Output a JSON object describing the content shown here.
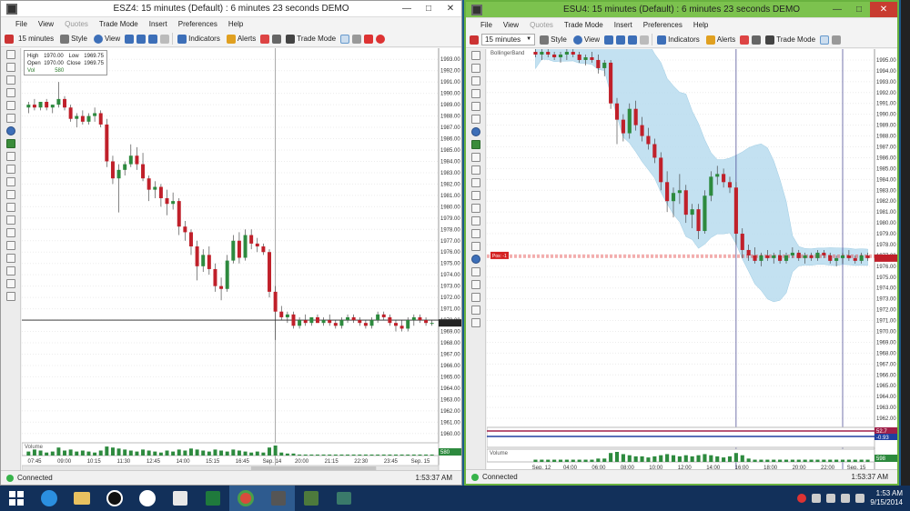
{
  "left_window": {
    "title": "ESZ4: 15 minutes (Default) : 6 minutes 23 seconds DEMO",
    "menu": [
      {
        "label": "File",
        "dim": false
      },
      {
        "label": "View",
        "dim": false
      },
      {
        "label": "Quotes",
        "dim": true
      },
      {
        "label": "Trade Mode",
        "dim": false
      },
      {
        "label": "Insert",
        "dim": false
      },
      {
        "label": "Preferences",
        "dim": false
      },
      {
        "label": "Help",
        "dim": false
      }
    ],
    "toolbar": {
      "interval": "15 minutes",
      "style": "Style",
      "view": "View",
      "indicators": "Indicators",
      "alerts": "Alerts",
      "trade_mode": "Trade Mode"
    },
    "databox": {
      "high_label": "High",
      "high": "1970.00",
      "low_label": "Low",
      "low": "1969.75",
      "open_label": "Open",
      "open": "1970.00",
      "close_label": "Close",
      "close": "1969.75",
      "vol_label": "Vol",
      "vol": "580"
    },
    "status": {
      "text": "Connected",
      "time": "1:53:37 AM"
    },
    "volume_label": "Volume",
    "price_tag": "1969.75",
    "vol_tag": "580"
  },
  "right_window": {
    "title": "ESU4: 15 minutes (Default) : 6 minutes 23 seconds DEMO",
    "menu": [
      {
        "label": "File",
        "dim": false
      },
      {
        "label": "View",
        "dim": false
      },
      {
        "label": "Quotes",
        "dim": true
      },
      {
        "label": "Trade Mode",
        "dim": false
      },
      {
        "label": "Insert",
        "dim": false
      },
      {
        "label": "Preferences",
        "dim": false
      },
      {
        "label": "Help",
        "dim": false
      }
    ],
    "toolbar": {
      "interval": "15 minutes",
      "style": "Style",
      "view": "View",
      "indicators": "Indicators",
      "alerts": "Alerts",
      "trade_mode": "Trade Mode"
    },
    "indicator_label": "BollingerBand",
    "position_tag": "Pos: -1",
    "status": {
      "text": "Connected",
      "time": "1:53:37 AM"
    },
    "volume_label": "Volume",
    "rsi_values": [
      "52.7",
      "-0.93"
    ],
    "vol_tag": "598"
  },
  "taskbar": {
    "time": "1:53 AM",
    "date": "9/15/2014",
    "apps": [
      "windows-start",
      "internet-explorer",
      "file-explorer",
      "media-app",
      "hp-app",
      "office-grid",
      "excel",
      "chrome",
      "trading-app-1",
      "trading-app-2",
      "photo-app"
    ]
  },
  "chart_data": [
    {
      "type": "candlestick",
      "symbol": "ESZ4",
      "interval": "15 minutes",
      "yticks": [
        "1993.00",
        "1992.00",
        "1991.00",
        "1990.00",
        "1989.00",
        "1988.00",
        "1987.00",
        "1986.00",
        "1985.00",
        "1984.00",
        "1983.00",
        "1982.00",
        "1981.00",
        "1980.00",
        "1979.00",
        "1978.00",
        "1977.00",
        "1976.00",
        "1975.00",
        "1974.00",
        "1973.00",
        "1972.00",
        "1971.00",
        "1970.00",
        "1969.00",
        "1968.00",
        "1967.00",
        "1966.00",
        "1965.00",
        "1964.00",
        "1963.00",
        "1962.00",
        "1961.00",
        "1960.00"
      ],
      "ylim": [
        1959.5,
        1993.5
      ],
      "xticks": [
        "07:45",
        "09:00",
        "10:15",
        "11:30",
        "12:45",
        "14:00",
        "15:15",
        "16:45",
        "Sep. 14",
        "20:00",
        "21:15",
        "22:30",
        "23:45",
        "Sep. 15"
      ],
      "ohlc": [
        [
          1988.75,
          1989.25,
          1988.25,
          1989.0
        ],
        [
          1989.0,
          1989.5,
          1988.5,
          1988.75
        ],
        [
          1988.75,
          1989.25,
          1988.5,
          1989.25
        ],
        [
          1989.25,
          1989.5,
          1988.5,
          1988.75
        ],
        [
          1988.75,
          1989.0,
          1988.25,
          1989.0
        ],
        [
          1989.0,
          1991.0,
          1988.75,
          1989.5
        ],
        [
          1989.5,
          1989.75,
          1988.5,
          1988.75
        ],
        [
          1988.75,
          1989.0,
          1987.5,
          1987.75
        ],
        [
          1987.75,
          1988.25,
          1987.0,
          1988.0
        ],
        [
          1988.0,
          1988.5,
          1987.25,
          1987.5
        ],
        [
          1987.5,
          1988.25,
          1987.25,
          1988.0
        ],
        [
          1988.0,
          1988.75,
          1987.5,
          1988.25
        ],
        [
          1988.25,
          1988.5,
          1987.0,
          1987.25
        ],
        [
          1987.25,
          1987.75,
          1983.5,
          1984.0
        ],
        [
          1984.0,
          1984.5,
          1982.0,
          1982.5
        ],
        [
          1982.5,
          1983.75,
          1979.5,
          1983.25
        ],
        [
          1983.25,
          1984.0,
          1982.75,
          1983.75
        ],
        [
          1983.75,
          1985.5,
          1983.5,
          1984.5
        ],
        [
          1984.5,
          1985.25,
          1983.25,
          1983.75
        ],
        [
          1983.75,
          1984.75,
          1982.25,
          1982.5
        ],
        [
          1982.5,
          1982.75,
          1980.5,
          1981.5
        ],
        [
          1981.5,
          1982.25,
          1980.75,
          1981.75
        ],
        [
          1981.75,
          1982.0,
          1980.0,
          1980.75
        ],
        [
          1980.75,
          1981.5,
          1979.25,
          1980.25
        ],
        [
          1980.25,
          1981.25,
          1979.75,
          1980.5
        ],
        [
          1980.5,
          1980.75,
          1977.5,
          1978.25
        ],
        [
          1978.25,
          1978.75,
          1977.0,
          1977.75
        ],
        [
          1977.75,
          1978.0,
          1975.75,
          1976.5
        ],
        [
          1976.5,
          1977.0,
          1973.5,
          1974.75
        ],
        [
          1974.75,
          1976.25,
          1974.25,
          1975.75
        ],
        [
          1975.75,
          1976.5,
          1974.0,
          1974.5
        ],
        [
          1974.5,
          1975.0,
          1972.5,
          1973.0
        ],
        [
          1973.0,
          1973.75,
          1971.75,
          1972.75
        ],
        [
          1972.75,
          1975.75,
          1972.5,
          1975.25
        ],
        [
          1975.25,
          1977.5,
          1975.0,
          1977.0
        ],
        [
          1977.0,
          1977.75,
          1975.0,
          1975.5
        ],
        [
          1975.5,
          1978.0,
          1975.25,
          1977.5
        ],
        [
          1977.5,
          1978.0,
          1976.25,
          1976.75
        ],
        [
          1976.75,
          1977.25,
          1976.0,
          1976.5
        ],
        [
          1976.5,
          1976.75,
          1975.75,
          1976.0
        ],
        [
          1976.0,
          1976.25,
          1972.0,
          1972.5
        ],
        [
          1972.5,
          1973.0,
          1968.25,
          1970.75
        ],
        [
          1970.75,
          1971.25,
          1970.0,
          1970.25
        ],
        [
          1970.25,
          1970.75,
          1969.75,
          1970.5
        ],
        [
          1970.5,
          1970.75,
          1969.25,
          1969.5
        ],
        [
          1969.5,
          1970.25,
          1969.25,
          1970.0
        ],
        [
          1970.0,
          1970.5,
          1969.5,
          1969.75
        ],
        [
          1969.75,
          1970.25,
          1969.5,
          1970.25
        ],
        [
          1970.25,
          1970.5,
          1969.75,
          1969.75
        ],
        [
          1969.75,
          1970.25,
          1969.5,
          1970.0
        ],
        [
          1970.0,
          1970.5,
          1969.5,
          1969.75
        ],
        [
          1969.75,
          1970.0,
          1969.25,
          1969.5
        ],
        [
          1969.5,
          1970.25,
          1969.25,
          1970.0
        ],
        [
          1970.0,
          1970.5,
          1969.75,
          1970.25
        ],
        [
          1970.25,
          1970.5,
          1969.75,
          1970.0
        ],
        [
          1970.0,
          1970.25,
          1969.5,
          1969.75
        ],
        [
          1969.75,
          1970.0,
          1969.25,
          1969.5
        ],
        [
          1969.5,
          1970.25,
          1969.25,
          1970.0
        ],
        [
          1970.0,
          1970.75,
          1969.75,
          1970.5
        ],
        [
          1970.5,
          1970.75,
          1970.0,
          1970.25
        ],
        [
          1970.25,
          1970.5,
          1969.5,
          1969.75
        ],
        [
          1969.75,
          1970.0,
          1969.0,
          1969.5
        ],
        [
          1969.5,
          1970.0,
          1969.0,
          1969.25
        ],
        [
          1969.25,
          1970.25,
          1969.0,
          1970.0
        ],
        [
          1970.0,
          1970.5,
          1969.5,
          1970.25
        ],
        [
          1970.25,
          1970.5,
          1969.75,
          1970.0
        ],
        [
          1970.0,
          1970.25,
          1969.5,
          1969.75
        ],
        [
          1969.75,
          1970.0,
          1969.5,
          1969.75
        ]
      ],
      "volume": [
        4,
        6,
        5,
        3,
        4,
        8,
        5,
        6,
        4,
        5,
        4,
        3,
        5,
        9,
        8,
        7,
        6,
        5,
        4,
        6,
        5,
        4,
        3,
        5,
        4,
        6,
        5,
        7,
        6,
        5,
        4,
        6,
        5,
        4,
        6,
        5,
        4,
        3,
        4,
        3,
        8,
        10,
        3,
        2,
        2,
        1,
        1,
        1,
        1,
        1,
        1,
        1,
        1,
        1,
        1,
        1,
        1,
        1,
        1,
        1,
        1,
        1,
        1,
        1,
        1,
        1,
        1,
        1
      ],
      "horizontal_lines": [
        1970.0
      ],
      "vertical_line_index": 41
    },
    {
      "type": "candlestick",
      "symbol": "ESU4",
      "interval": "15 minutes",
      "indicator": "BollingerBand",
      "yticks": [
        "1995.00",
        "1994.00",
        "1993.00",
        "1992.00",
        "1991.00",
        "1990.00",
        "1989.00",
        "1988.00",
        "1987.00",
        "1986.00",
        "1985.00",
        "1984.00",
        "1983.00",
        "1982.00",
        "1981.00",
        "1980.00",
        "1979.00",
        "1978.00",
        "1977.00",
        "1976.00",
        "1975.00",
        "1974.00",
        "1973.00",
        "1972.00",
        "1971.00",
        "1970.00",
        "1969.00",
        "1968.00",
        "1967.00",
        "1966.00",
        "1965.00",
        "1964.00",
        "1963.00",
        "1962.00"
      ],
      "ylim": [
        1961.5,
        1995.5
      ],
      "xticks": [
        "Sep. 12",
        "04:00",
        "06:00",
        "08:00",
        "10:00",
        "12:00",
        "14:00",
        "16:00",
        "18:00",
        "20:00",
        "22:00",
        "Sep. 15"
      ],
      "ohlc": [
        [
          1995.75,
          1996.0,
          1995.25,
          1995.5
        ],
        [
          1995.5,
          1996.0,
          1995.0,
          1995.75
        ],
        [
          1995.75,
          1996.0,
          1995.25,
          1995.5
        ],
        [
          1995.5,
          1995.75,
          1995.0,
          1995.25
        ],
        [
          1995.25,
          1995.75,
          1994.75,
          1995.5
        ],
        [
          1995.5,
          1996.0,
          1995.0,
          1995.75
        ],
        [
          1995.75,
          1996.0,
          1995.25,
          1995.5
        ],
        [
          1995.5,
          1995.75,
          1994.75,
          1995.0
        ],
        [
          1995.0,
          1995.5,
          1994.5,
          1995.25
        ],
        [
          1995.25,
          1995.75,
          1994.75,
          1995.0
        ],
        [
          1995.0,
          1995.5,
          1993.75,
          1994.25
        ],
        [
          1994.25,
          1995.0,
          1993.5,
          1994.75
        ],
        [
          1994.75,
          1995.0,
          1990.5,
          1991.0
        ],
        [
          1991.0,
          1991.5,
          1987.25,
          1989.5
        ],
        [
          1989.5,
          1990.0,
          1987.5,
          1988.25
        ],
        [
          1988.25,
          1991.0,
          1987.75,
          1990.5
        ],
        [
          1990.5,
          1991.25,
          1988.5,
          1989.0
        ],
        [
          1989.0,
          1989.75,
          1987.5,
          1988.0
        ],
        [
          1988.0,
          1988.75,
          1986.75,
          1987.25
        ],
        [
          1987.25,
          1987.75,
          1985.5,
          1986.0
        ],
        [
          1986.0,
          1986.5,
          1983.0,
          1983.75
        ],
        [
          1983.75,
          1984.75,
          1981.0,
          1982.0
        ],
        [
          1982.0,
          1983.25,
          1980.5,
          1982.75
        ],
        [
          1982.75,
          1984.5,
          1981.75,
          1983.0
        ],
        [
          1983.0,
          1983.5,
          1980.0,
          1980.75
        ],
        [
          1980.75,
          1981.75,
          1979.5,
          1981.25
        ],
        [
          1981.25,
          1981.75,
          1978.5,
          1979.25
        ],
        [
          1979.25,
          1983.0,
          1979.0,
          1982.5
        ],
        [
          1982.5,
          1984.75,
          1982.0,
          1984.25
        ],
        [
          1984.25,
          1985.25,
          1983.5,
          1984.5
        ],
        [
          1984.5,
          1985.0,
          1983.25,
          1983.75
        ],
        [
          1983.75,
          1984.25,
          1982.75,
          1983.25
        ],
        [
          1983.25,
          1983.75,
          1978.0,
          1979.0
        ],
        [
          1979.0,
          1979.5,
          1976.75,
          1977.5
        ],
        [
          1977.5,
          1978.0,
          1976.5,
          1977.0
        ],
        [
          1977.0,
          1977.75,
          1976.25,
          1976.5
        ],
        [
          1976.5,
          1977.25,
          1976.0,
          1977.0
        ],
        [
          1977.0,
          1977.5,
          1976.5,
          1976.75
        ],
        [
          1976.75,
          1977.25,
          1976.25,
          1977.0
        ],
        [
          1977.0,
          1977.5,
          1976.25,
          1976.5
        ],
        [
          1976.5,
          1977.25,
          1976.25,
          1977.0
        ],
        [
          1977.0,
          1977.75,
          1976.75,
          1977.25
        ],
        [
          1977.25,
          1977.5,
          1976.5,
          1976.75
        ],
        [
          1976.75,
          1977.25,
          1976.25,
          1977.0
        ],
        [
          1977.0,
          1977.25,
          1976.5,
          1976.75
        ],
        [
          1976.75,
          1977.5,
          1976.5,
          1977.25
        ],
        [
          1977.25,
          1977.5,
          1976.75,
          1977.0
        ],
        [
          1977.0,
          1977.25,
          1976.25,
          1976.5
        ],
        [
          1976.5,
          1977.0,
          1976.0,
          1976.75
        ],
        [
          1976.75,
          1977.25,
          1976.25,
          1977.0
        ],
        [
          1977.0,
          1977.5,
          1976.5,
          1976.75
        ],
        [
          1976.75,
          1977.0,
          1976.25,
          1976.5
        ],
        [
          1976.5,
          1977.25,
          1976.25,
          1977.0
        ],
        [
          1977.0,
          1977.25,
          1976.5,
          1976.75
        ]
      ],
      "volume": [
        2,
        2,
        2,
        2,
        2,
        2,
        2,
        2,
        2,
        2,
        3,
        3,
        8,
        9,
        7,
        6,
        5,
        5,
        4,
        5,
        6,
        7,
        6,
        5,
        6,
        5,
        6,
        7,
        6,
        5,
        4,
        5,
        8,
        6,
        3,
        2,
        2,
        2,
        2,
        2,
        2,
        2,
        2,
        2,
        2,
        2,
        2,
        2,
        2,
        2,
        2,
        2,
        2,
        2
      ],
      "position_price": 1977.0,
      "vertical_line_indices": [
        32,
        49
      ]
    }
  ]
}
